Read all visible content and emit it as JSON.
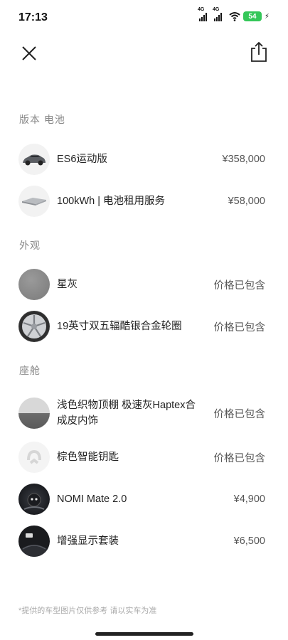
{
  "status": {
    "time": "17:13",
    "net1": "4G",
    "net2": "4G",
    "battery": "54"
  },
  "header": {
    "close_icon": "close-icon",
    "share_icon": "share-icon"
  },
  "sections": {
    "version": {
      "title": "版本 电池",
      "items": [
        {
          "label": "ES6运动版",
          "price": "¥358,000",
          "icon": "car-icon"
        },
        {
          "label": "100kWh | 电池租用服务",
          "price": "¥58,000",
          "icon": "battery-pack-icon"
        }
      ]
    },
    "exterior": {
      "title": "外观",
      "items": [
        {
          "label": "星灰",
          "price": "价格已包含",
          "icon": "color-swatch-icon"
        },
        {
          "label": "19英寸双五辐酷银合金轮圈",
          "price": "价格已包含",
          "icon": "wheel-icon"
        }
      ]
    },
    "cabin": {
      "title": "座舱",
      "items": [
        {
          "label": "浅色织物顶棚 极速灰Haptex合成皮内饰",
          "price": "价格已包含",
          "icon": "interior-swatch-icon"
        },
        {
          "label": "棕色智能钥匙",
          "price": "价格已包含",
          "icon": "key-icon"
        },
        {
          "label": "NOMI Mate 2.0",
          "price": "¥4,900",
          "icon": "nomi-icon"
        },
        {
          "label": "增强显示套装",
          "price": "¥6,500",
          "icon": "display-icon"
        }
      ]
    }
  },
  "footer": {
    "disclaimer": "*提供的车型图片仅供参考   请以实车为准"
  },
  "colors": {
    "battery_green": "#34c759",
    "swatch_gray": "#8a8a8a"
  }
}
